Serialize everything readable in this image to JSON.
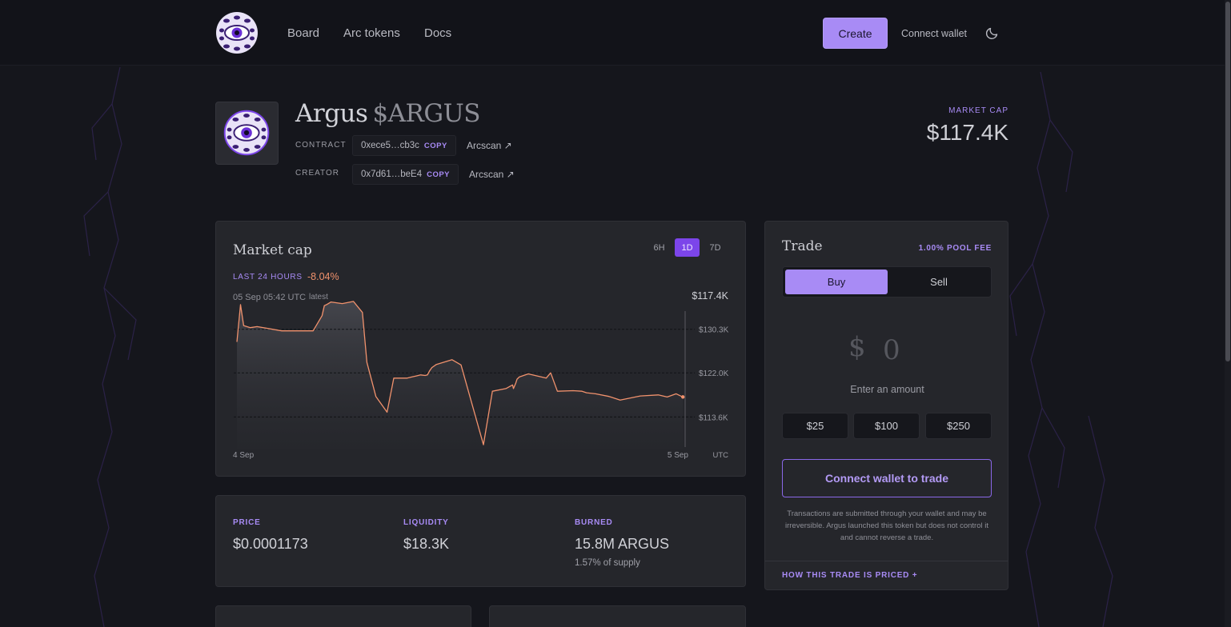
{
  "nav": {
    "links": [
      "Board",
      "Arc tokens",
      "Docs"
    ],
    "create_label": "Create",
    "connect_label": "Connect wallet"
  },
  "token": {
    "name": "Argus",
    "symbol": "$ARGUS",
    "contract_label": "CONTRACT",
    "contract_address": "0xece5…cb3c",
    "creator_label": "CREATOR",
    "creator_address": "0x7d61…beE4",
    "copy_label": "COPY",
    "explorer_label": "Arcscan ↗",
    "market_cap_label": "MARKET CAP",
    "market_cap_value": "$117.4K"
  },
  "chart_panel": {
    "title": "Market cap",
    "ranges": [
      "6H",
      "1D",
      "7D"
    ],
    "active_range": "1D",
    "period_label": "LAST 24 HOURS",
    "change": "-8.04%",
    "timestamp": "05 Sep 05:42 UTC",
    "latest_label": "latest",
    "current_value": "$117.4K"
  },
  "chart_data": {
    "type": "area",
    "x_ticks": [
      "4 Sep",
      "5 Sep"
    ],
    "x_unit": "UTC",
    "y_ticks": [
      "$130.3K",
      "$122.0K",
      "$113.6K"
    ],
    "y_tick_values": [
      130.3,
      122.0,
      113.6
    ],
    "ylim": [
      107.4,
      136.2
    ],
    "line_color": "#f1926d",
    "grid": true,
    "series": [
      {
        "x": [
          0.0,
          0.008,
          0.015,
          0.03,
          0.045,
          0.1,
          0.17,
          0.19,
          0.195,
          0.2,
          0.2,
          0.21,
          0.235,
          0.26,
          0.28,
          0.29,
          0.31,
          0.335,
          0.335,
          0.35,
          0.37,
          0.38,
          0.39,
          0.4,
          0.41,
          0.42,
          0.425,
          0.43,
          0.435,
          0.445,
          0.48,
          0.5,
          0.55,
          0.57,
          0.6,
          0.615,
          0.617,
          0.622,
          0.625,
          0.63,
          0.65,
          0.69,
          0.7,
          0.715,
          0.75,
          0.77,
          0.78,
          0.8,
          0.83,
          0.855,
          0.9,
          0.94,
          0.96,
          0.98,
          0.995
        ],
        "values": [
          127.9,
          135.0,
          131.0,
          130.6,
          130.8,
          130.0,
          130.0,
          132.9,
          134.8,
          135.0,
          135.0,
          135.5,
          135.2,
          135.6,
          133.5,
          124.0,
          117.5,
          114.5,
          114.5,
          121.0,
          121.0,
          121.0,
          121.2,
          121.4,
          121.6,
          121.5,
          121.6,
          122.4,
          123.0,
          123.6,
          124.5,
          123.5,
          108.3,
          118.5,
          119.0,
          119.7,
          119.0,
          120.0,
          120.8,
          121.2,
          121.8,
          121.0,
          122.0,
          118.5,
          118.6,
          118.5,
          118.2,
          118.0,
          117.5,
          116.8,
          117.6,
          117.8,
          117.4,
          118.0,
          117.4
        ]
      }
    ]
  },
  "stats": {
    "price_label": "PRICE",
    "price_value": "$0.0001173",
    "liquidity_label": "LIQUIDITY",
    "liquidity_value": "$18.3K",
    "burned_label": "BURNED",
    "burned_value": "15.8M ARGUS",
    "burned_sub": "1.57% of supply"
  },
  "trade": {
    "title": "Trade",
    "fee": "1.00% POOL FEE",
    "buy_label": "Buy",
    "sell_label": "Sell",
    "currency_symbol": "$",
    "amount_value": "0",
    "amount_hint": "Enter an amount",
    "presets": [
      "$25",
      "$100",
      "$250"
    ],
    "connect_label": "Connect wallet to trade",
    "disclaimer": "Transactions are submitted through your wallet and may be irreversible. Argus launched this token but does not control it and cannot reverse a trade.",
    "how_priced": "HOW THIS TRADE IS PRICED +"
  },
  "colors": {
    "accent": "#a88bf5",
    "active_range": "#7c45ea",
    "negative": "#f1926d"
  },
  "icons": {
    "theme": "moon-icon",
    "logo": "eye-orb-logo"
  }
}
